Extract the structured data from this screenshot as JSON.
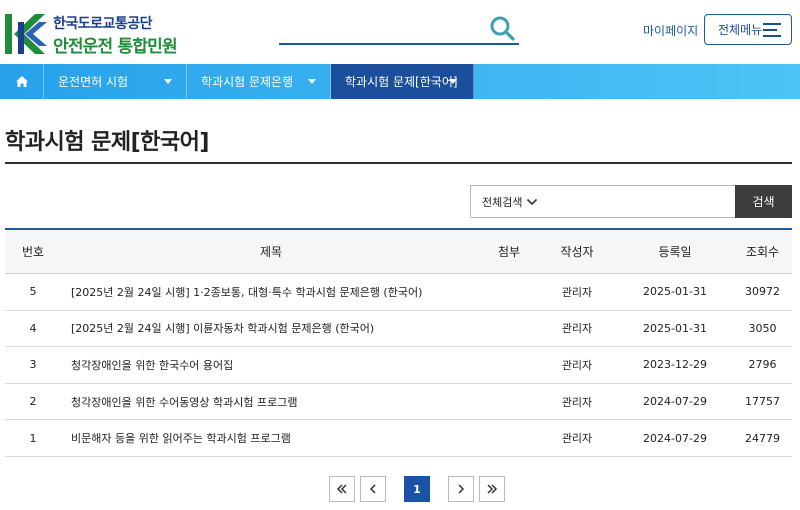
{
  "header": {
    "logo_line1": "한국도로교통공단",
    "logo_line2": "안전운전 통합민원",
    "search_placeholder": "",
    "mypage_label": "마이페이지",
    "allmenu_label": "전체메뉴"
  },
  "nav": {
    "items": [
      {
        "label": "운전면허 시험"
      },
      {
        "label": "학과시험 문제은행"
      },
      {
        "label": "학과시험 문제[한국어]"
      }
    ]
  },
  "page": {
    "title": "학과시험 문제[한국어]"
  },
  "search": {
    "select_value": "전체검색",
    "input_placeholder": "",
    "button_label": "검색"
  },
  "table": {
    "headers": {
      "no": "번호",
      "title": "제목",
      "file": "첨부",
      "writer": "작성자",
      "date": "등록일",
      "views": "조회수"
    },
    "rows": [
      {
        "no": "5",
        "title": "[2025년 2월 24일 시행] 1·2종보통, 대형·특수 학과시험 문제은행 (한국어)",
        "writer": "관리자",
        "date": "2025-01-31",
        "views": "30972"
      },
      {
        "no": "4",
        "title": "[2025년 2월 24일 시행] 이륜자동차 학과시험 문제은행 (한국어)",
        "writer": "관리자",
        "date": "2025-01-31",
        "views": "3050"
      },
      {
        "no": "3",
        "title": "청각장애인을 위한 한국수어 용어집",
        "writer": "관리자",
        "date": "2023-12-29",
        "views": "2796"
      },
      {
        "no": "2",
        "title": "청각장애인을 위한 수어동영상 학과시험 프로그램",
        "writer": "관리자",
        "date": "2024-07-29",
        "views": "17757"
      },
      {
        "no": "1",
        "title": "비문해자 등을 위한 읽어주는 학과시험 프로그램",
        "writer": "관리자",
        "date": "2024-07-29",
        "views": "24779"
      }
    ]
  },
  "pager": {
    "current": "1"
  },
  "colors": {
    "brand_blue": "#1c5a9f",
    "nav_active": "#1b4f9c",
    "nav_bg": "#3fb6f2",
    "logo_green": "#1f8c3a",
    "search_button": "#3c3c3c"
  }
}
